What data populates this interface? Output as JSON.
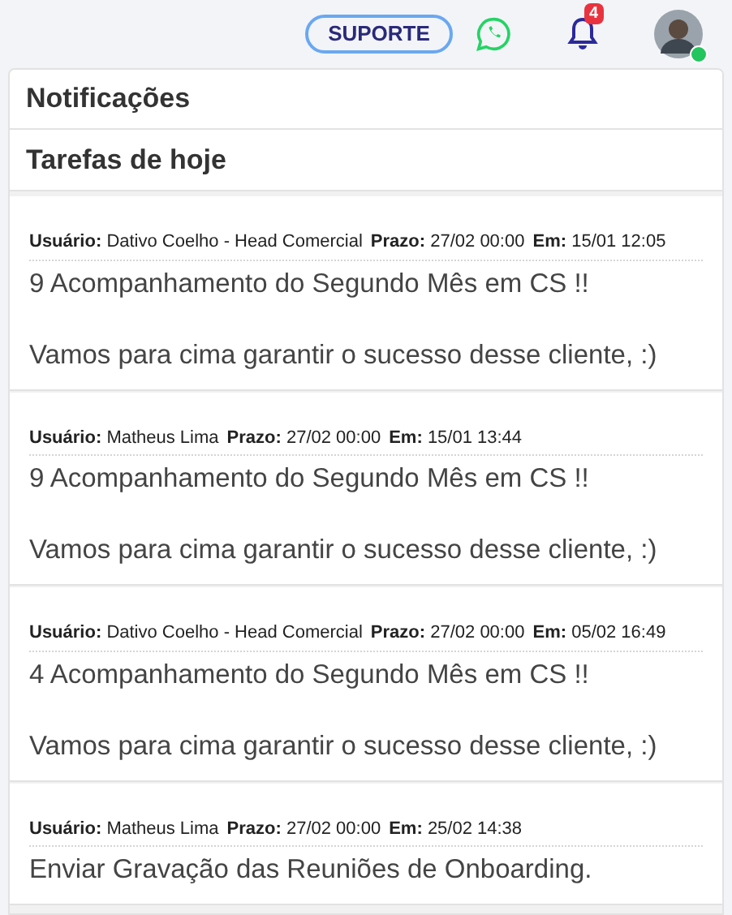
{
  "topbar": {
    "support_button": "SUPORTE",
    "notification_count": "4"
  },
  "panel": {
    "title": "Notificações",
    "section_title": "Tarefas de hoje",
    "tasks": [
      {
        "meta": [
          {
            "label": "Usuário:",
            "value": "Dativo Coelho - Head Comercial"
          },
          {
            "label": "Prazo:",
            "value": "27/02 00:00"
          },
          {
            "label": "Em:",
            "value": "15/01 12:05"
          }
        ],
        "title": "9 Acompanhamento do Segundo Mês em CS !!",
        "body": "Vamos para cima garantir o sucesso desse cliente, :)"
      },
      {
        "meta": [
          {
            "label": "Usuário:",
            "value": "Matheus Lima"
          },
          {
            "label": "Prazo:",
            "value": "27/02 00:00"
          },
          {
            "label": "Em:",
            "value": "15/01 13:44"
          }
        ],
        "title": "9 Acompanhamento do Segundo Mês em CS !!",
        "body": "Vamos para cima garantir o sucesso desse cliente, :)"
      },
      {
        "meta": [
          {
            "label": "Usuário:",
            "value": "Dativo Coelho - Head Comercial"
          },
          {
            "label": "Prazo:",
            "value": "27/02 00:00"
          },
          {
            "label": "Em:",
            "value": "05/02 16:49"
          }
        ],
        "title": "4 Acompanhamento do Segundo Mês em CS !!",
        "body": "Vamos para cima garantir o sucesso desse cliente, :)"
      },
      {
        "meta": [
          {
            "label": "Usuário:",
            "value": "Matheus Lima"
          },
          {
            "label": "Prazo:",
            "value": "27/02 00:00"
          },
          {
            "label": "Em:",
            "value": "25/02 14:38"
          }
        ],
        "title": "Enviar Gravação das Reuniões de Onboarding."
      }
    ]
  }
}
